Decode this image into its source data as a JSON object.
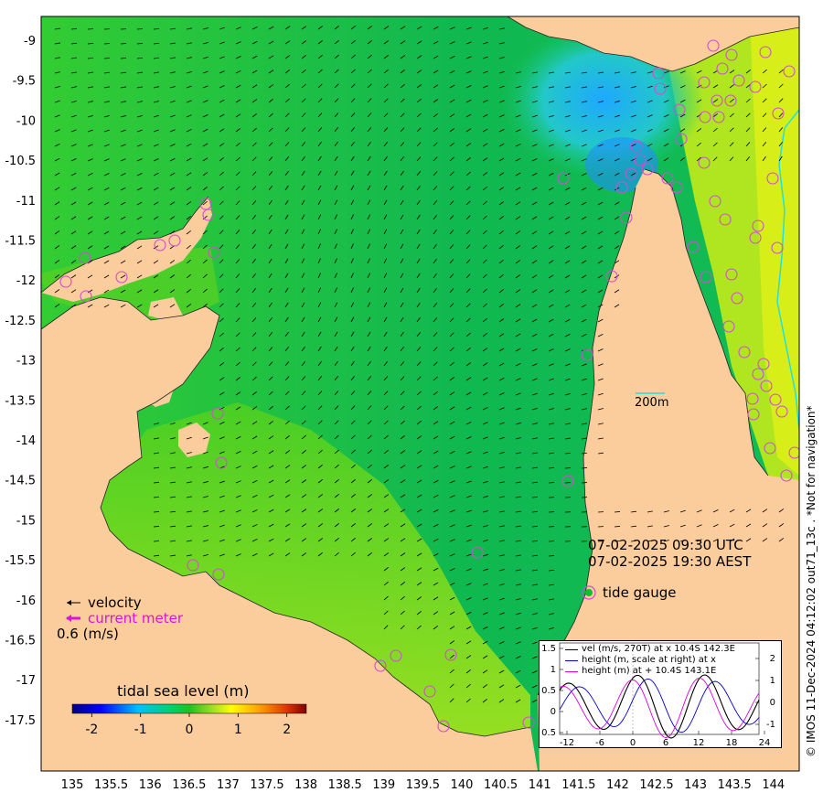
{
  "map": {
    "y_labels": [
      "-9",
      "-9.5",
      "-10",
      "-10.5",
      "-11",
      "-11.5",
      "-12",
      "-12.5",
      "-13",
      "-13.5",
      "-14",
      "-14.5",
      "-15",
      "-15.5",
      "-16",
      "-16.5",
      "-17",
      "-17.5"
    ],
    "x_labels": [
      "135",
      "135.5",
      "136",
      "136.5",
      "137",
      "137.5",
      "138",
      "138.5",
      "139",
      "139.5",
      "140",
      "140.5",
      "141",
      "141.5",
      "142",
      "142.5",
      "143",
      "143.5",
      "144"
    ],
    "scale_bar_label": "200m",
    "time_utc": "07-02-2025 09:30 UTC",
    "time_aest": "07-02-2025 19:30 AEST",
    "tide_gauge_label": "tide gauge",
    "velocity_label": "velocity",
    "current_meter_label": "current meter",
    "speed_ref_label": "0.6 (m/s)",
    "credit": "© IMOS 11-Dec-2024 04:12:02 out71_13c . *Not for navigation*",
    "colors": {
      "land": "#fbcc9c",
      "gauge_ring": "#d34bd3",
      "current_meter": "#e010e0",
      "arrow": "#000000"
    }
  },
  "colorbar": {
    "title": "tidal sea level (m)",
    "tick_labels": [
      "-2",
      "-1",
      "0",
      "1",
      "2"
    ],
    "range": [
      -2.4,
      2.4
    ]
  },
  "inset": {
    "legend": [
      {
        "label": "vel (m/s, 270T) at x 10.4S 142.3E",
        "color": "#000000"
      },
      {
        "label": "height (m, scale at right) at x",
        "color": "#0000cc"
      },
      {
        "label": "height (m) at + 10.4S 143.1E",
        "color": "#dd00dd"
      }
    ],
    "left_ticks": [
      "1.5",
      "1",
      "0.5",
      "0",
      "0.5"
    ],
    "right_ticks": [
      "2",
      "1",
      "0",
      "-1"
    ],
    "x_ticks": [
      "-12",
      "-6",
      "0",
      "6",
      "12",
      "18",
      "24"
    ]
  }
}
